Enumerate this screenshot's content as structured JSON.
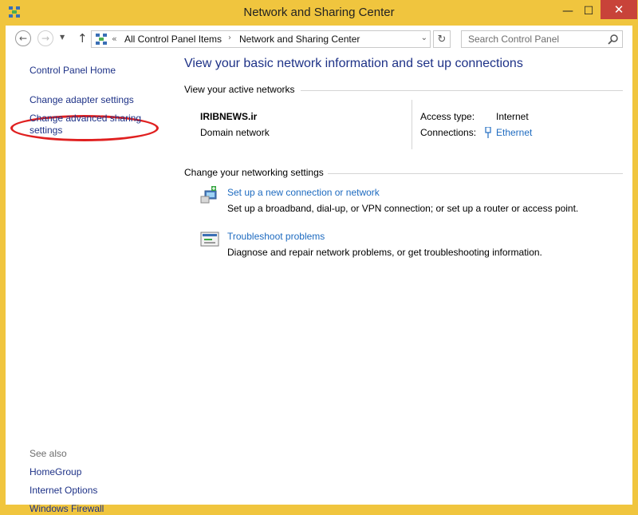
{
  "window": {
    "title": "Network and Sharing Center",
    "min_glyph": "—",
    "max_glyph": "☐",
    "close_glyph": "✕"
  },
  "address": {
    "chevron": "«",
    "crumbs": [
      "All Control Panel Items",
      "Network and Sharing Center"
    ],
    "separator": "›"
  },
  "search": {
    "placeholder": "Search Control Panel"
  },
  "sidebar": {
    "home": "Control Panel Home",
    "adapter": "Change adapter settings",
    "advanced_line1": "Change advanced sharing",
    "advanced_line2": "settings",
    "see_also": "See also",
    "homegroup": "HomeGroup",
    "internet_options": "Internet Options",
    "firewall": "Windows Firewall"
  },
  "main": {
    "heading": "View your basic network information and set up connections",
    "active_networks_label": "View your active networks",
    "network_name": "IRIBNEWS.ir",
    "network_type": "Domain network",
    "access_type_label": "Access type:",
    "access_type_value": "Internet",
    "connections_label": "Connections:",
    "connections_value": "Ethernet",
    "change_settings_label": "Change your networking settings",
    "task1_link": "Set up a new connection or network",
    "task1_desc": "Set up a broadband, dial-up, or VPN connection; or set up a router or access point.",
    "task2_link": "Troubleshoot problems",
    "task2_desc": "Diagnose and repair network problems, or get troubleshooting information."
  },
  "colors": {
    "frame": "#f0c53e",
    "close": "#c84339",
    "link_dark": "#1e3287",
    "link": "#1e6bc0",
    "annotation": "#e02020"
  },
  "icons": [
    "network-center-icon",
    "back-arrow-icon",
    "forward-arrow-icon",
    "chevron-down-icon",
    "up-arrow-icon",
    "refresh-icon",
    "search-icon",
    "ethernet-icon",
    "new-connection-icon",
    "troubleshoot-icon"
  ]
}
